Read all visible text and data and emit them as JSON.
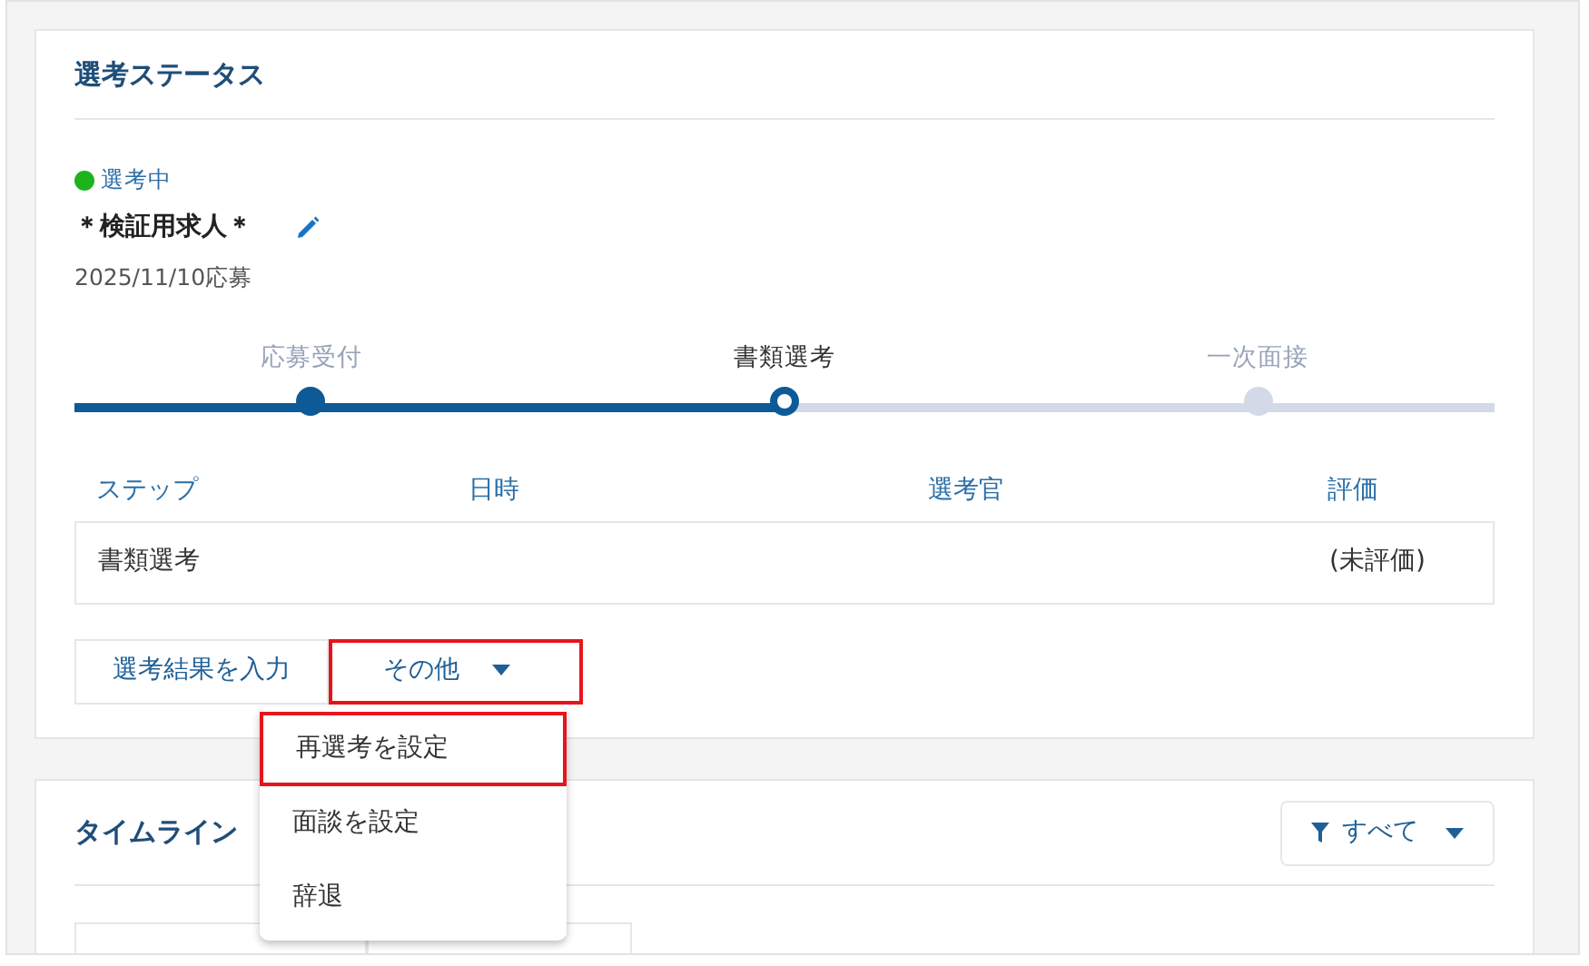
{
  "selection_status": {
    "title": "選考ステータス",
    "status": {
      "label": "選考中",
      "color": "#1db31d"
    },
    "job_title": "＊検証用求人＊",
    "applied_date": "2025/11/10応募",
    "steps": [
      {
        "label": "応募受付",
        "done": true,
        "selected": false
      },
      {
        "label": "書類選考",
        "done": false,
        "selected": true
      },
      {
        "label": "一次面接",
        "done": false,
        "selected": false
      }
    ],
    "table": {
      "columns": [
        "ステップ",
        "日時",
        "選考官",
        "評価"
      ],
      "rows": [
        [
          "書類選考",
          "",
          "",
          "(未評価)"
        ]
      ]
    },
    "buttons": [
      {
        "label": "選考結果を入力",
        "kind": "plain",
        "highlighted": false
      },
      {
        "label": "その他",
        "kind": "dropdown",
        "highlighted": true
      }
    ]
  },
  "dropdown_menu": [
    {
      "label": "再選考を設定",
      "highlighted": true
    },
    {
      "label": "面談を設定",
      "highlighted": false
    },
    {
      "label": "辞退",
      "highlighted": false
    }
  ],
  "timeline": {
    "title": "タイムライン",
    "filter": "すべて"
  }
}
